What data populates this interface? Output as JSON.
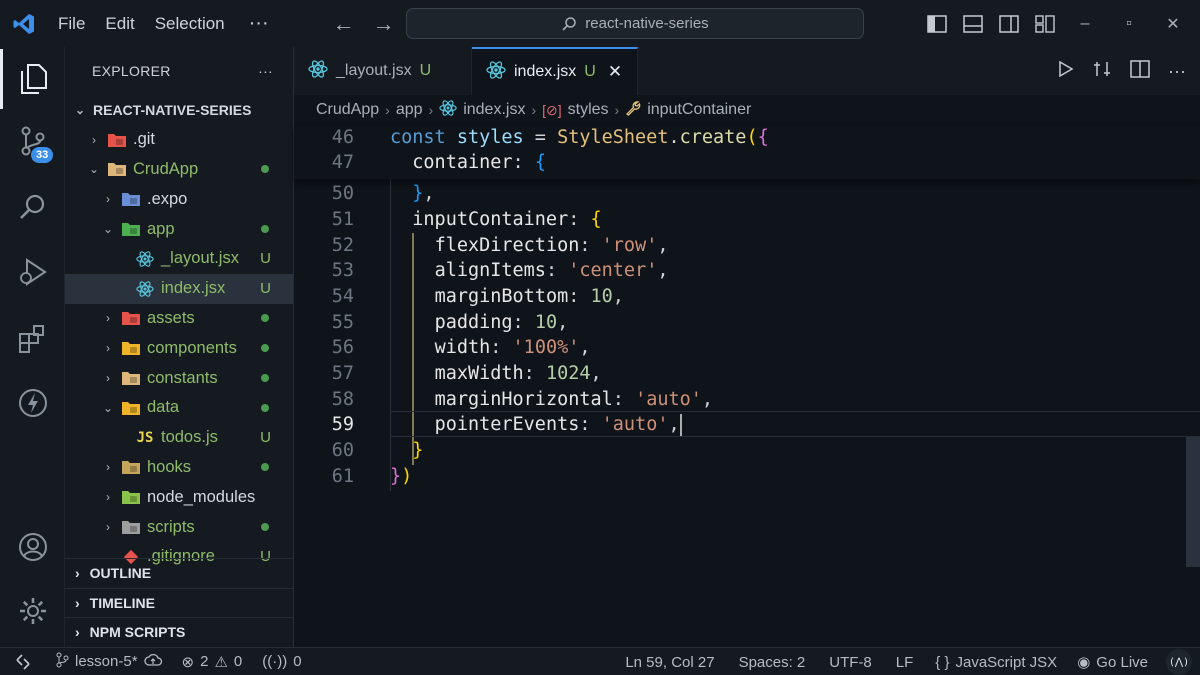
{
  "titlebar": {
    "menu": [
      "File",
      "Edit",
      "Selection"
    ],
    "more": "···",
    "search_text": "react-native-series"
  },
  "activity": {
    "scm_badge": "33"
  },
  "explorer": {
    "title": "EXPLORER",
    "more": "···",
    "root": "REACT-NATIVE-SERIES",
    "items": [
      {
        "label": ".git",
        "depth": 1,
        "chev": "›",
        "icon": "git-folder-icon",
        "status": ""
      },
      {
        "label": "CrudApp",
        "depth": 1,
        "chev": "⌄",
        "icon": "folder-open-icon",
        "status": "dot"
      },
      {
        "label": ".expo",
        "depth": 2,
        "chev": "›",
        "icon": "expo-folder-icon",
        "status": ""
      },
      {
        "label": "app",
        "depth": 2,
        "chev": "⌄",
        "icon": "app-folder-icon",
        "status": "dot"
      },
      {
        "label": "_layout.jsx",
        "depth": 3,
        "chev": "",
        "icon": "react-icon",
        "status": "U"
      },
      {
        "label": "index.jsx",
        "depth": 3,
        "chev": "",
        "icon": "react-icon",
        "status": "U",
        "selected": true
      },
      {
        "label": "assets",
        "depth": 2,
        "chev": "›",
        "icon": "assets-folder-icon",
        "status": "dot"
      },
      {
        "label": "components",
        "depth": 2,
        "chev": "›",
        "icon": "components-folder-icon",
        "status": "dot"
      },
      {
        "label": "constants",
        "depth": 2,
        "chev": "›",
        "icon": "folder-icon",
        "status": "dot"
      },
      {
        "label": "data",
        "depth": 2,
        "chev": "⌄",
        "icon": "data-folder-icon",
        "status": "dot"
      },
      {
        "label": "todos.js",
        "depth": 3,
        "chev": "",
        "icon": "js-icon",
        "status": "U"
      },
      {
        "label": "hooks",
        "depth": 2,
        "chev": "›",
        "icon": "hooks-folder-icon",
        "status": "dot"
      },
      {
        "label": "node_modules",
        "depth": 2,
        "chev": "›",
        "icon": "node-folder-icon",
        "status": ""
      },
      {
        "label": "scripts",
        "depth": 2,
        "chev": "›",
        "icon": "scripts-folder-icon",
        "status": "dot"
      },
      {
        "label": ".gitignore",
        "depth": 2,
        "chev": "",
        "icon": "git-file-icon",
        "status": "U"
      }
    ],
    "sections": [
      "OUTLINE",
      "TIMELINE",
      "NPM SCRIPTS"
    ]
  },
  "tabs": [
    {
      "label": "_layout.jsx",
      "status": "U",
      "active": false
    },
    {
      "label": "index.jsx",
      "status": "U",
      "active": true
    }
  ],
  "breadcrumbs": [
    "CrudApp",
    "app",
    "index.jsx",
    "styles",
    "inputContainer"
  ],
  "editor": {
    "lines": [
      {
        "n": "46",
        "tokens": [
          [
            "kw",
            "const "
          ],
          [
            "var",
            "styles "
          ],
          [
            "p",
            "= "
          ],
          [
            "cls",
            "StyleSheet"
          ],
          [
            "p",
            "."
          ],
          [
            "fn",
            "create"
          ],
          [
            "br1",
            "("
          ],
          [
            "br2",
            "{"
          ]
        ]
      },
      {
        "n": "47",
        "tokens": [
          [
            "p",
            "  "
          ],
          [
            "prop",
            "container"
          ],
          [
            "p",
            ": "
          ],
          [
            "br3",
            "{"
          ]
        ]
      },
      {
        "n": "50",
        "tokens": [
          [
            "p",
            "  "
          ],
          [
            "br3",
            "}"
          ],
          [
            "p",
            ","
          ]
        ]
      },
      {
        "n": "51",
        "tokens": [
          [
            "p",
            "  "
          ],
          [
            "prop",
            "inputContainer"
          ],
          [
            "p",
            ": "
          ],
          [
            "br1",
            "{"
          ]
        ]
      },
      {
        "n": "52",
        "tokens": [
          [
            "p",
            "    "
          ],
          [
            "prop",
            "flexDirection"
          ],
          [
            "p",
            ": "
          ],
          [
            "str",
            "'row'"
          ],
          [
            "p",
            ","
          ]
        ]
      },
      {
        "n": "53",
        "tokens": [
          [
            "p",
            "    "
          ],
          [
            "prop",
            "alignItems"
          ],
          [
            "p",
            ": "
          ],
          [
            "str",
            "'center'"
          ],
          [
            "p",
            ","
          ]
        ]
      },
      {
        "n": "54",
        "tokens": [
          [
            "p",
            "    "
          ],
          [
            "prop",
            "marginBottom"
          ],
          [
            "p",
            ": "
          ],
          [
            "num",
            "10"
          ],
          [
            "p",
            ","
          ]
        ]
      },
      {
        "n": "55",
        "tokens": [
          [
            "p",
            "    "
          ],
          [
            "prop",
            "padding"
          ],
          [
            "p",
            ": "
          ],
          [
            "num",
            "10"
          ],
          [
            "p",
            ","
          ]
        ]
      },
      {
        "n": "56",
        "tokens": [
          [
            "p",
            "    "
          ],
          [
            "prop",
            "width"
          ],
          [
            "p",
            ": "
          ],
          [
            "str",
            "'100%'"
          ],
          [
            "p",
            ","
          ]
        ]
      },
      {
        "n": "57",
        "tokens": [
          [
            "p",
            "    "
          ],
          [
            "prop",
            "maxWidth"
          ],
          [
            "p",
            ": "
          ],
          [
            "num",
            "1024"
          ],
          [
            "p",
            ","
          ]
        ]
      },
      {
        "n": "58",
        "tokens": [
          [
            "p",
            "    "
          ],
          [
            "prop",
            "marginHorizontal"
          ],
          [
            "p",
            ": "
          ],
          [
            "str",
            "'auto'"
          ],
          [
            "p",
            ","
          ]
        ]
      },
      {
        "n": "59",
        "tokens": [
          [
            "p",
            "    "
          ],
          [
            "prop",
            "pointerEvents"
          ],
          [
            "p",
            ": "
          ],
          [
            "str",
            "'auto'"
          ],
          [
            "p",
            ","
          ]
        ],
        "current": true
      },
      {
        "n": "60",
        "tokens": [
          [
            "p",
            "  "
          ],
          [
            "br1",
            "}"
          ]
        ]
      },
      {
        "n": "61",
        "tokens": [
          [
            "br2",
            "}"
          ],
          [
            "br1",
            ")"
          ]
        ]
      }
    ]
  },
  "statusbar": {
    "branch": "lesson-5*",
    "errors": "2",
    "warnings": "0",
    "ports": "0",
    "position": "Ln 59, Col 27",
    "spaces": "Spaces: 2",
    "encoding": "UTF-8",
    "eol": "LF",
    "language": "JavaScript JSX",
    "golive": "Go Live"
  },
  "colors": {
    "accent": "#3b8eea",
    "git_added": "#8fbc6a",
    "bg": "#0f141a"
  }
}
